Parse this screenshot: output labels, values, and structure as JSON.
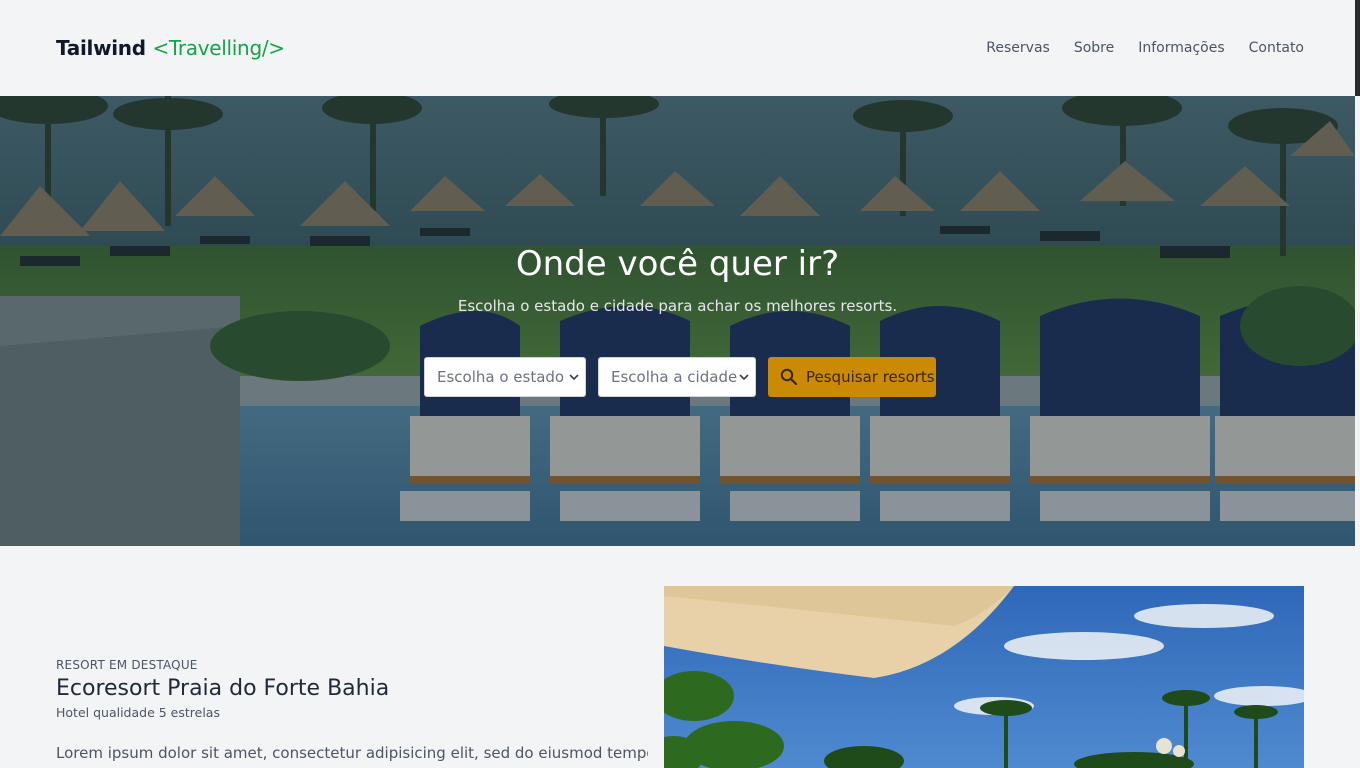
{
  "header": {
    "logo_main": "Tailwind",
    "logo_accent": "<Travelling/>",
    "nav": [
      {
        "label": "Reservas"
      },
      {
        "label": "Sobre"
      },
      {
        "label": "Informações"
      },
      {
        "label": "Contato"
      }
    ]
  },
  "hero": {
    "title": "Onde você quer ir?",
    "subtitle": "Escolha o estado e cidade para achar os melhores resorts.",
    "state_select": "Escolha o estado",
    "city_select": "Escolha a cidade",
    "search_button": "Pesquisar resorts"
  },
  "featured": {
    "eyebrow": "Resort em destaque",
    "title": "Ecoresort Praia do Forte Bahia",
    "subtitle": "Hotel qualidade 5 estrelas",
    "body": "Lorem ipsum dolor sit amet, consectetur adipisicing elit, sed do eiusmod tempor"
  },
  "colors": {
    "accent_green": "#16a34a",
    "button_amber": "#ca8a04",
    "page_bg": "#f3f4f6"
  },
  "icons": {
    "search": "search-icon",
    "chevron": "chevron-down-icon"
  }
}
